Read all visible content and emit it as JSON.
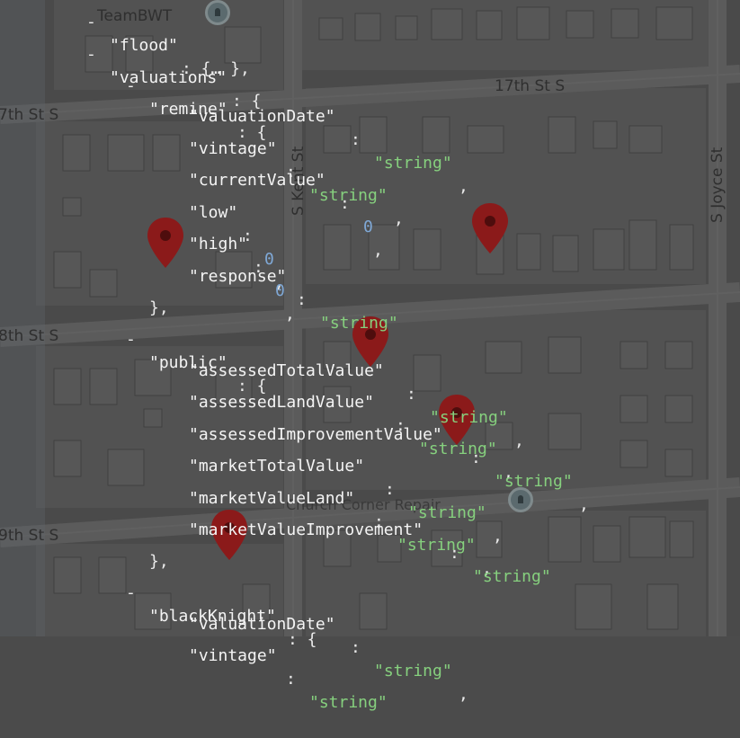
{
  "map": {
    "streets": [
      "17th St S",
      "7th St S",
      "8th St S",
      "9th St S",
      "S Kent St",
      "S Joyce St"
    ],
    "place_labels": [
      "TeamBWT",
      "Church Corner Repair"
    ],
    "marker_color": "#8b1a1a"
  },
  "json_view": {
    "lines": [
      {
        "key": "\"flood\"",
        "rest": ": {… },"
      },
      {
        "key": "\"valuations\"",
        "rest": ": {",
        "dash": "-"
      },
      {
        "key": "\"remine\"",
        "rest": ": {",
        "dash": "-"
      },
      {
        "key": "\"valuationDate\"",
        "value": "\"string\"",
        "type": "str"
      },
      {
        "key": "\"vintage\"",
        "value": "\"string\"",
        "type": "str"
      },
      {
        "key": "\"currentValue\"",
        "value": "0",
        "type": "num"
      },
      {
        "key": "\"low\"",
        "value": "0",
        "type": "num"
      },
      {
        "key": "\"high\"",
        "value": "0",
        "type": "num"
      },
      {
        "key": "\"response\"",
        "value": "\"string\"",
        "type": "str",
        "last": true
      },
      {
        "close": "},"
      },
      {
        "key": "\"public\"",
        "rest": ": {",
        "dash": "-"
      },
      {
        "key": "\"assessedTotalValue\"",
        "value": "\"string\"",
        "type": "str"
      },
      {
        "key": "\"assessedLandValue\"",
        "value": "\"string\"",
        "type": "str"
      },
      {
        "key": "\"assessedImprovementValue\"",
        "value": "\"string\"",
        "type": "str"
      },
      {
        "key": "\"marketTotalValue\"",
        "value": "\"string\"",
        "type": "str"
      },
      {
        "key": "\"marketValueLand\"",
        "value": "\"string\"",
        "type": "str"
      },
      {
        "key": "\"marketValueImprovement\"",
        "value": "\"string\"",
        "type": "str",
        "last": true
      },
      {
        "close": "},"
      },
      {
        "key": "\"blackKnight\"",
        "rest": ": {",
        "dash": "-"
      },
      {
        "key": "\"valuationDate\"",
        "value": "\"string\"",
        "type": "str"
      },
      {
        "key": "\"vintage\"",
        "value": "\"string\"",
        "type": "str"
      }
    ]
  }
}
